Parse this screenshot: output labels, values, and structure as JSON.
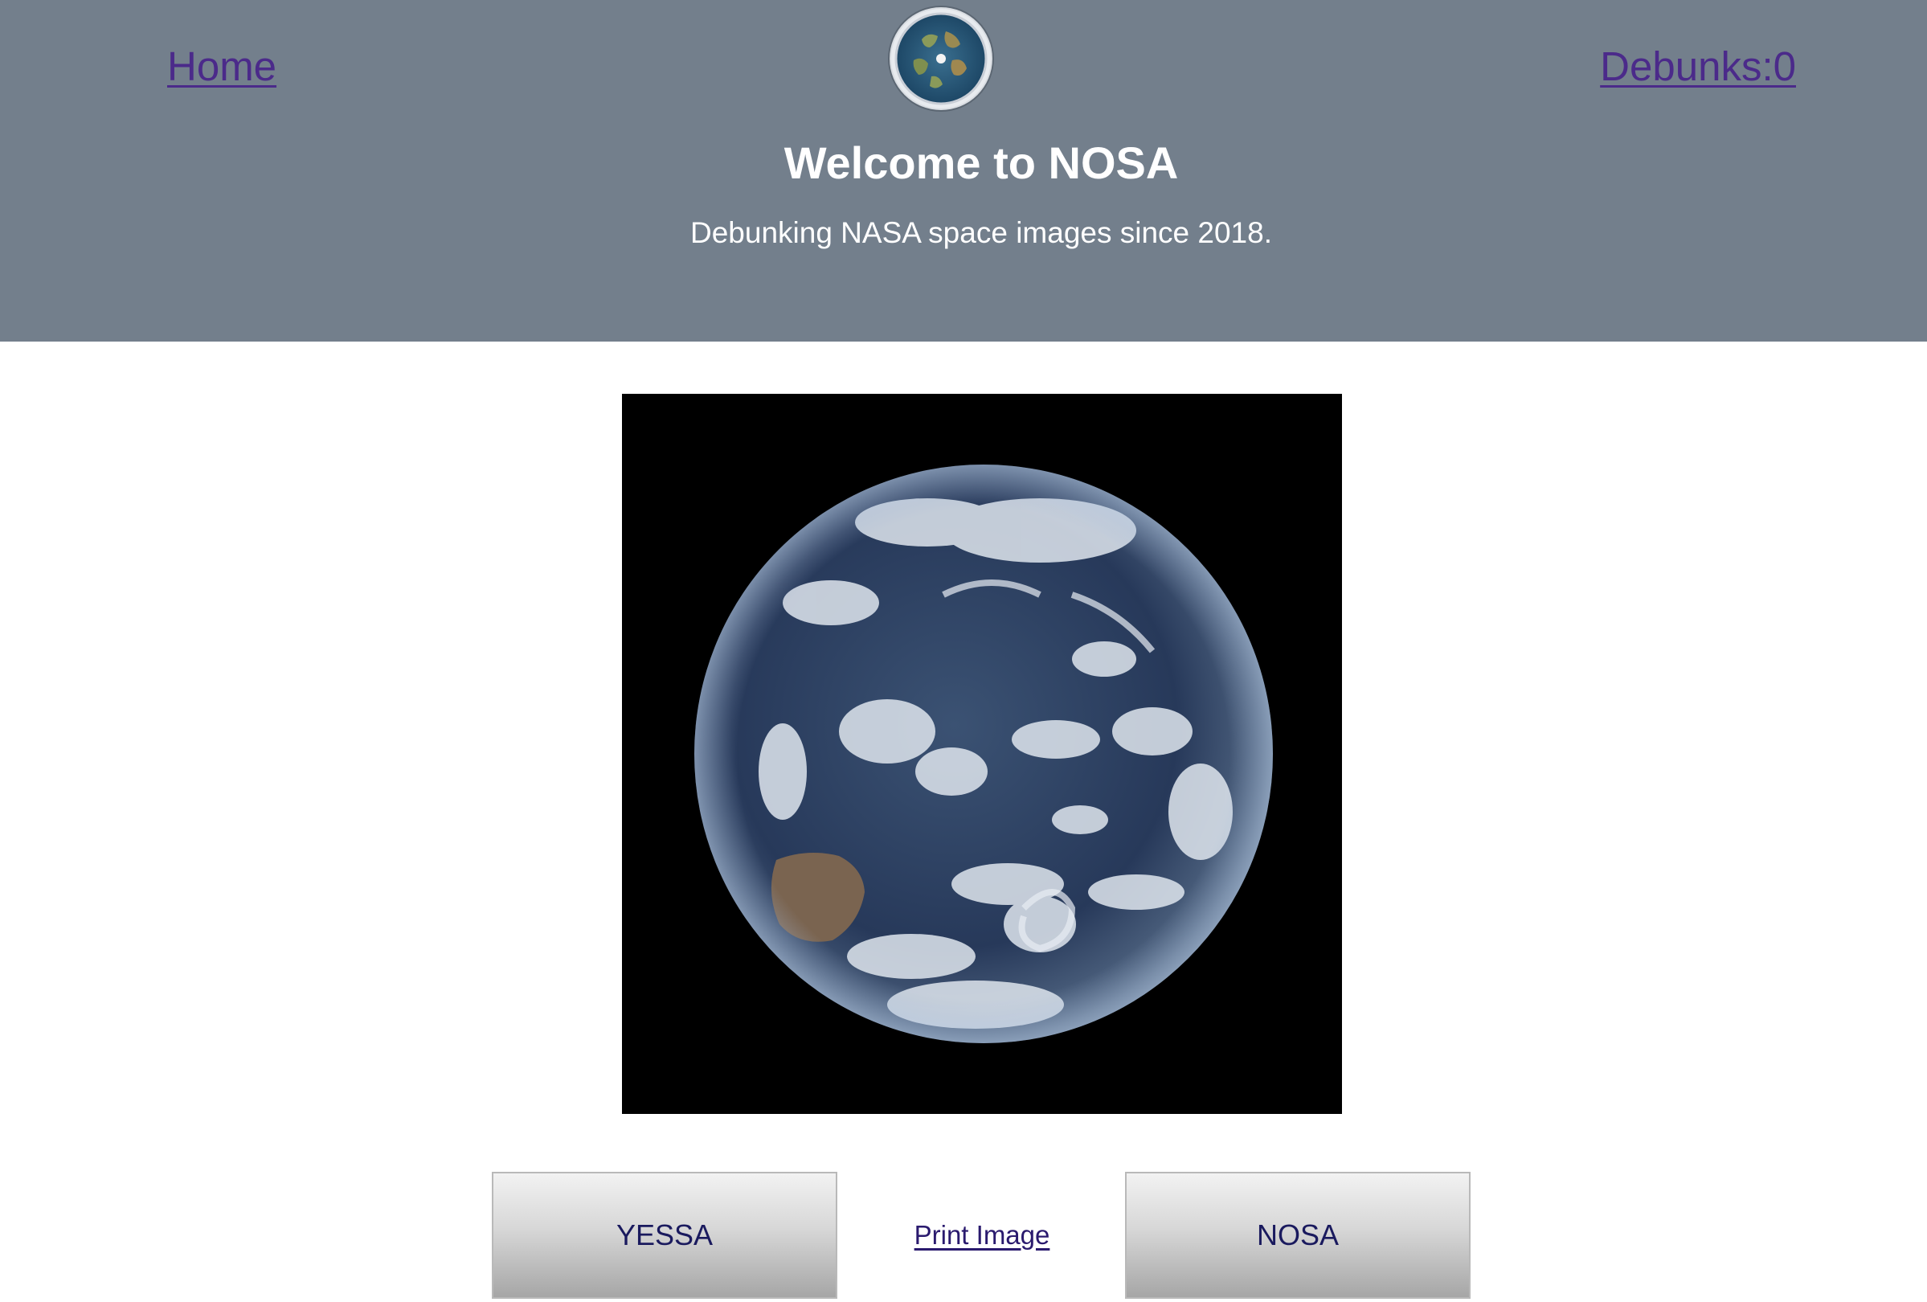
{
  "nav": {
    "home_label": "Home",
    "debunks_label": "Debunks:0"
  },
  "header": {
    "title": "Welcome to NOSA",
    "subtitle": "Debunking NASA space images since 2018."
  },
  "actions": {
    "yes_label": "YESSA",
    "print_label": "Print Image",
    "no_label": "NOSA"
  },
  "colors": {
    "header_bg": "#737f8c",
    "link": "#4b2a8a",
    "photo_bg": "#000000"
  },
  "icons": {
    "logo": "flat-earth-map-logo"
  }
}
